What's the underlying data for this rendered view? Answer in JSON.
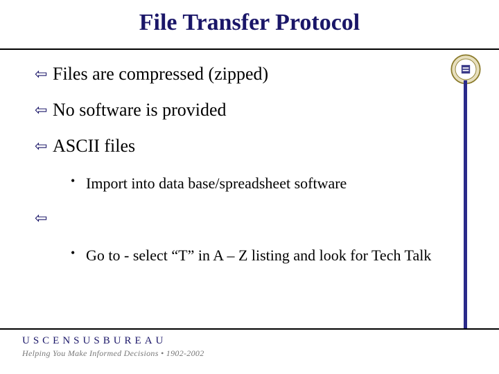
{
  "title": "File Transfer Protocol",
  "bullets": {
    "b1": "Files are compressed (zipped)",
    "b2": "No software is provided",
    "b3": "ASCII files",
    "b3_sub": "Import into data base/spreadsheet software",
    "b4": "",
    "b4_sub": "Go to                                   - select “T” in A – Z listing and look for Tech Talk"
  },
  "icons": {
    "arrow": "⇦",
    "dot": "•"
  },
  "footer": {
    "brand": "USCENSUSBUREAU",
    "tagline": "Helping You Make Informed Decisions • 1902-2002"
  }
}
